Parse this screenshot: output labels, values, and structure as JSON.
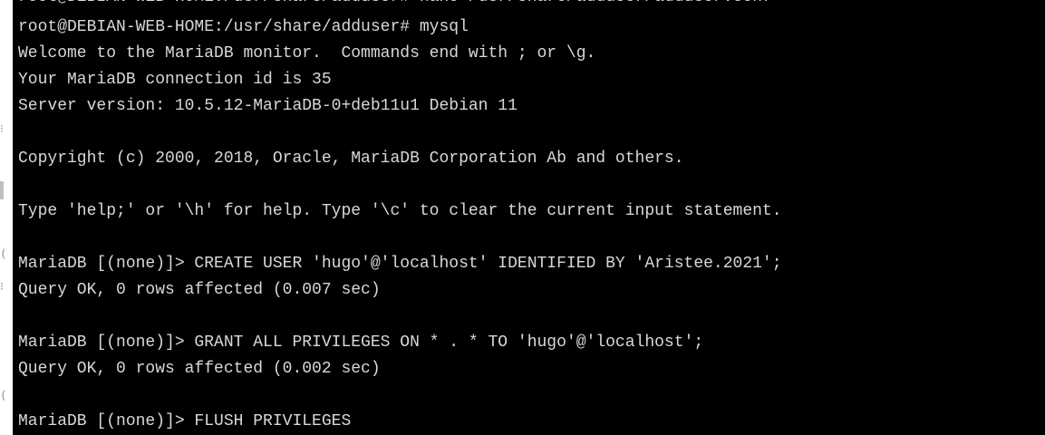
{
  "terminal": {
    "lines": [
      "root@DEBIAN-WEB-HOME:/usr/share/adduser# nano /usr/share/adduser/adduser.conf",
      "root@DEBIAN-WEB-HOME:/usr/share/adduser# mysql",
      "Welcome to the MariaDB monitor.  Commands end with ; or \\g.",
      "Your MariaDB connection id is 35",
      "Server version: 10.5.12-MariaDB-0+deb11u1 Debian 11",
      "",
      "Copyright (c) 2000, 2018, Oracle, MariaDB Corporation Ab and others.",
      "",
      "Type 'help;' or '\\h' for help. Type '\\c' to clear the current input statement.",
      "",
      "MariaDB [(none)]> CREATE USER 'hugo'@'localhost' IDENTIFIED BY 'Aristee.2021';",
      "Query OK, 0 rows affected (0.007 sec)",
      "",
      "MariaDB [(none)]> GRANT ALL PRIVILEGES ON * . * TO 'hugo'@'localhost';",
      "Query OK, 0 rows affected (0.002 sec)",
      "",
      "MariaDB [(none)]> FLUSH PRIVILEGES"
    ]
  },
  "colors": {
    "background": "#000000",
    "text": "#d8d8d8"
  }
}
